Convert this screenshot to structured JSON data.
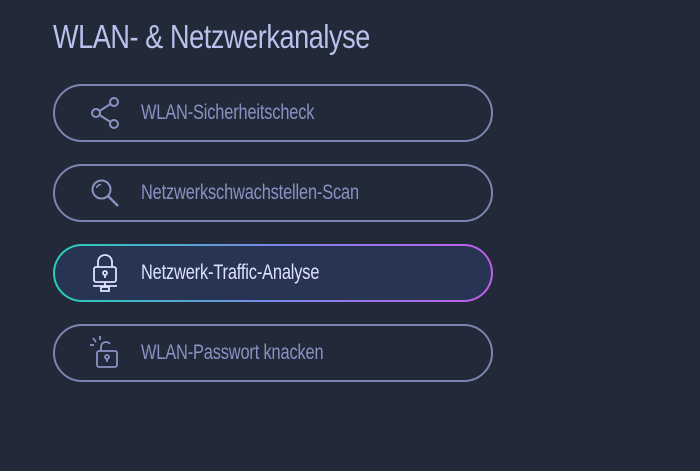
{
  "title": "WLAN- & Netzwerkanalyse",
  "menu": {
    "items": [
      {
        "label": "WLAN-Sicherheitscheck",
        "icon": "share-icon",
        "active": false
      },
      {
        "label": "Netzwerkschwachstellen-Scan",
        "icon": "search-icon",
        "active": false
      },
      {
        "label": "Netzwerk-Traffic-Analyse",
        "icon": "network-lock-icon",
        "active": true
      },
      {
        "label": "WLAN-Passwort knacken",
        "icon": "lock-crack-icon",
        "active": false
      }
    ]
  },
  "colors": {
    "background": "#222939",
    "border": "#7d84b0",
    "text": "#8a92c4",
    "active_text": "#dde2ff",
    "active_gradient_start": "#23d3b5",
    "active_gradient_end": "#c25de8"
  }
}
